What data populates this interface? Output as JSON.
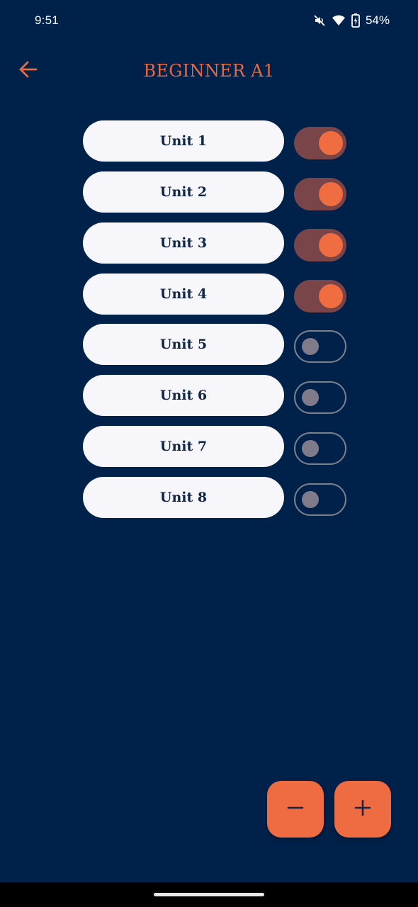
{
  "status_bar": {
    "time": "9:51",
    "battery": "54%",
    "icons": [
      "mute-icon",
      "wifi-icon",
      "battery-icon"
    ]
  },
  "header": {
    "title": "BEGINNER A1",
    "back_icon": "arrow-left-icon"
  },
  "units": [
    {
      "label": "Unit 1",
      "enabled": true
    },
    {
      "label": "Unit 2",
      "enabled": true
    },
    {
      "label": "Unit 3",
      "enabled": true
    },
    {
      "label": "Unit 4",
      "enabled": true
    },
    {
      "label": "Unit 5",
      "enabled": false
    },
    {
      "label": "Unit 6",
      "enabled": false
    },
    {
      "label": "Unit 7",
      "enabled": false
    },
    {
      "label": "Unit 8",
      "enabled": false
    }
  ],
  "fabs": {
    "minus_icon": "minus-icon",
    "plus_icon": "plus-icon"
  },
  "colors": {
    "background": "#00214a",
    "accent": "#ef6b42",
    "pill": "#f7f6fb",
    "switch_on_track": "#7a4549",
    "switch_off_border": "#7c7f8c"
  }
}
